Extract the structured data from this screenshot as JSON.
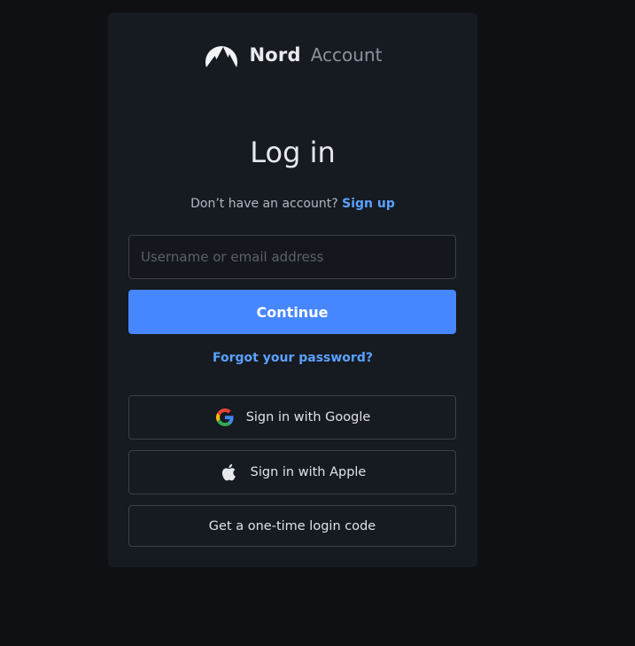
{
  "brand": {
    "name": "Nord",
    "product": "Account",
    "logo_icon": "nord-mountain-icon"
  },
  "login": {
    "title": "Log in",
    "signup_prompt": "Don’t have an account?",
    "signup_link": "Sign up",
    "username_placeholder": "Username or email address",
    "username_value": "",
    "continue_label": "Continue",
    "forgot_password": "Forgot your password?",
    "google_label": "Sign in with Google",
    "apple_label": "Sign in with Apple",
    "code_label": "Get a one-time login code"
  },
  "colors": {
    "page_background": "#0e1014",
    "card_background": "#161a21",
    "accent": "#4687ff",
    "link": "#5aa2ff"
  }
}
